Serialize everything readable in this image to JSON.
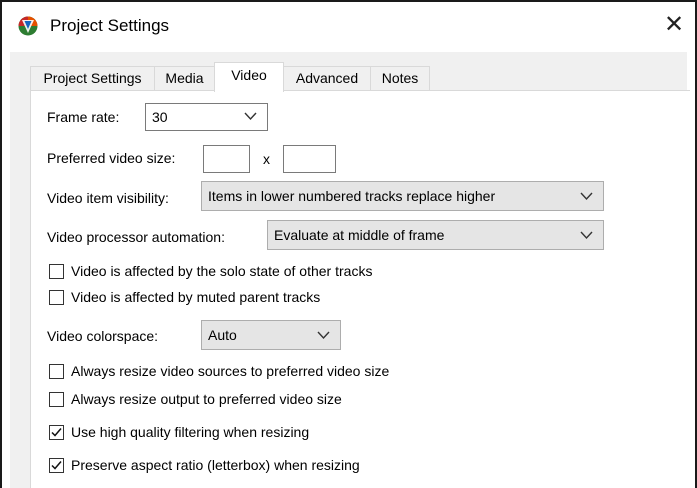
{
  "window": {
    "title": "Project Settings",
    "close_glyph": "✕"
  },
  "tabs": [
    {
      "label": "Project Settings",
      "active": false
    },
    {
      "label": "Media",
      "active": false
    },
    {
      "label": "Video",
      "active": true
    },
    {
      "label": "Advanced",
      "active": false
    },
    {
      "label": "Notes",
      "active": false
    }
  ],
  "video": {
    "frame_rate_label": "Frame rate:",
    "frame_rate_value": "30",
    "preferred_size_label": "Preferred video size:",
    "preferred_width": "",
    "preferred_height": "",
    "size_separator": "x",
    "visibility_label": "Video item visibility:",
    "visibility_value": "Items in lower numbered tracks replace higher",
    "processor_label": "Video processor automation:",
    "processor_value": "Evaluate at middle of frame",
    "colorspace_label": "Video colorspace:",
    "colorspace_value": "Auto",
    "checkboxes": [
      {
        "label": "Video is affected by the solo state of other tracks",
        "checked": false
      },
      {
        "label": "Video is affected by muted parent tracks",
        "checked": false
      },
      {
        "label": "Always resize video sources to preferred video size",
        "checked": false
      },
      {
        "label": "Always resize output to preferred video size",
        "checked": false
      },
      {
        "label": "Use high quality filtering when resizing",
        "checked": true
      },
      {
        "label": "Preserve aspect ratio (letterbox) when resizing",
        "checked": true
      }
    ]
  },
  "icons": {
    "app": "reaper-logo-icon",
    "close": "close-icon",
    "dropdown": "chevron-down-icon",
    "check": "checkmark-icon"
  },
  "colors": {
    "tab_border": "#d9d9d9",
    "client_bg": "#f0f0f0",
    "field_border": "#7a7a7a"
  }
}
